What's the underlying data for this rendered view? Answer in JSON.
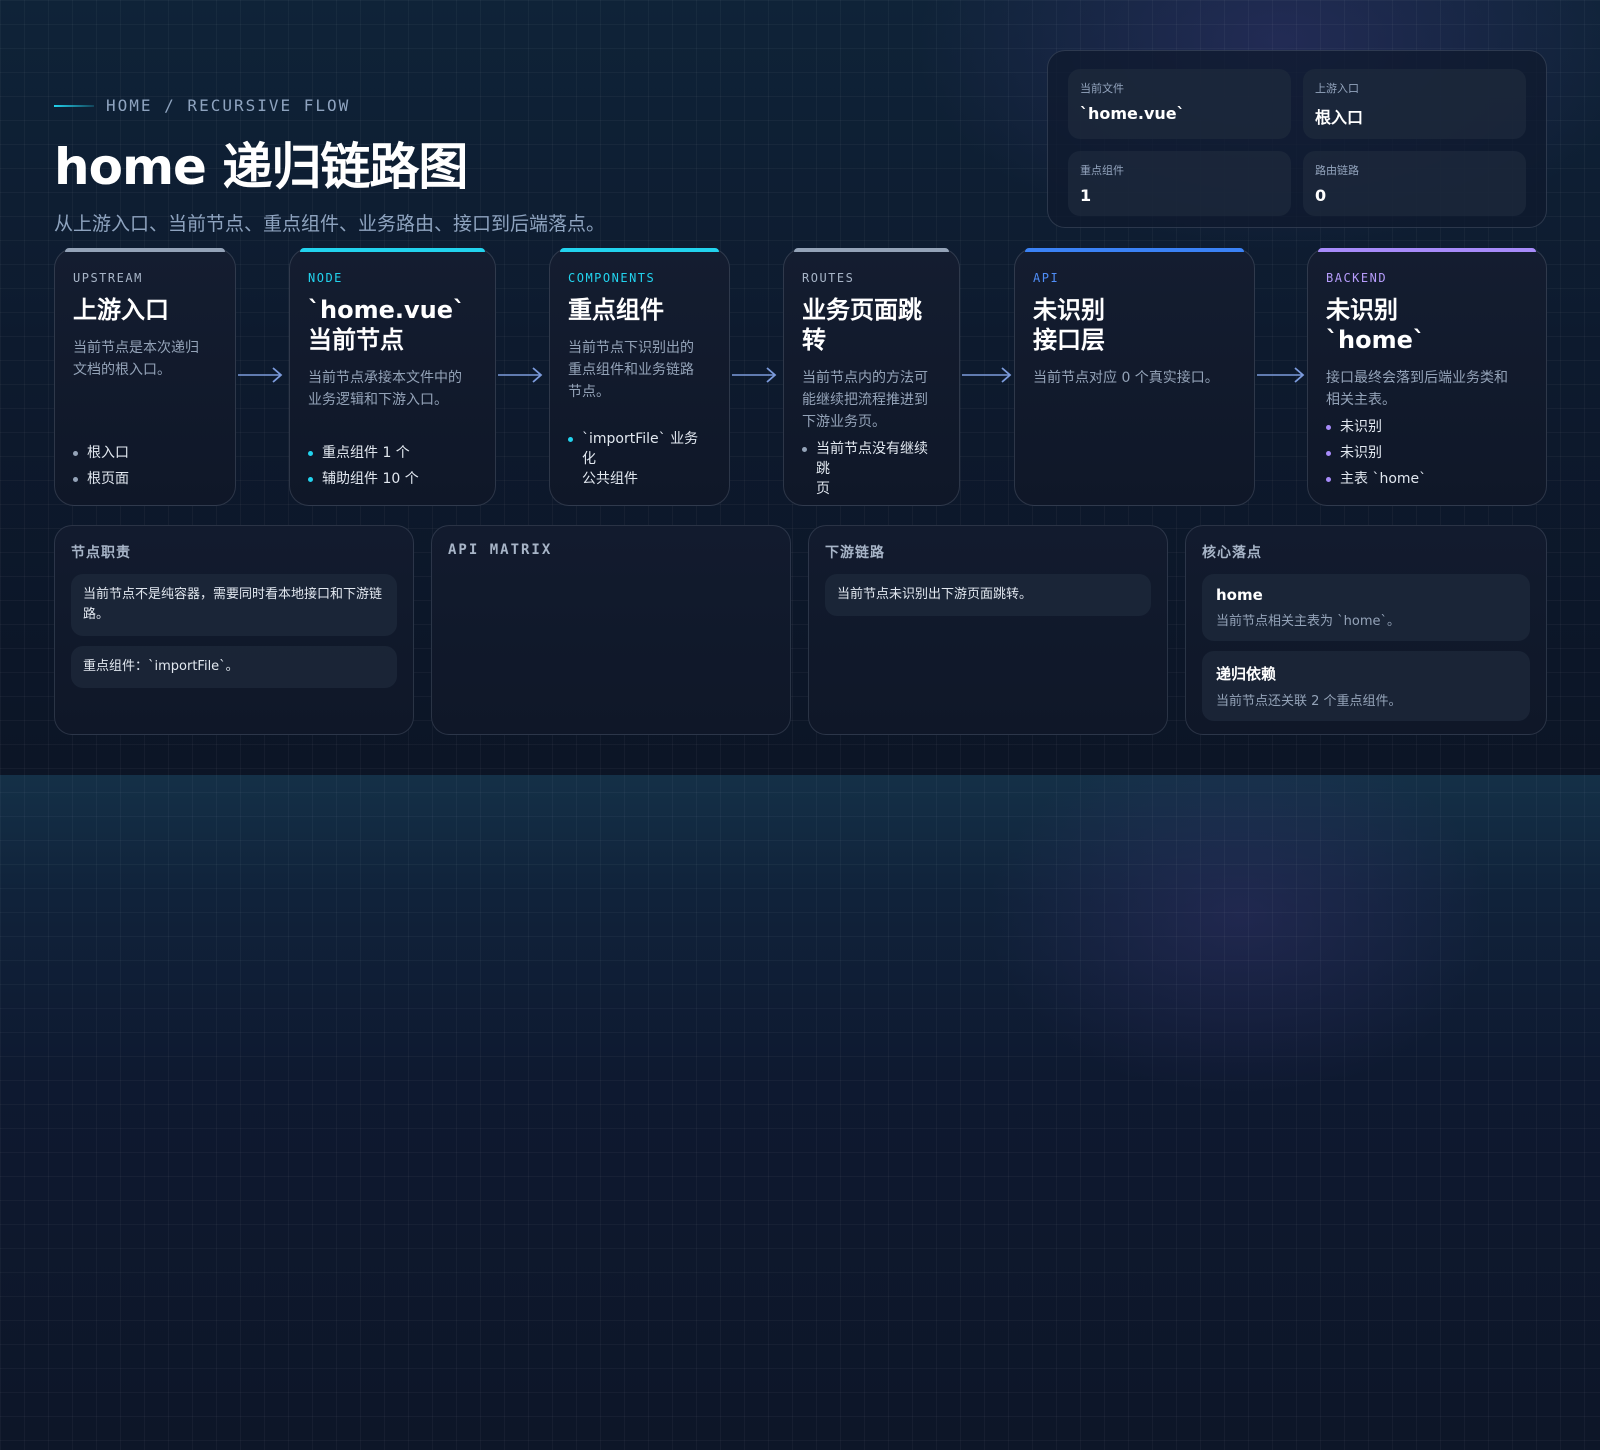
{
  "breadcrumb": "HOME / RECURSIVE FLOW",
  "title": "home 递归链路图",
  "subtitle": "从上游入口、当前节点、重点组件、业务路由、接口到后端落点。",
  "stats": [
    {
      "label": "当前文件",
      "value": "`home.vue`"
    },
    {
      "label": "上游入口",
      "value": "根入口"
    },
    {
      "label": "重点组件",
      "value": "1"
    },
    {
      "label": "路由链路",
      "value": "0"
    }
  ],
  "flow": [
    {
      "tag": "UPSTREAM",
      "title": "上游入口",
      "desc": "当前节点是本次递归\n文档的根入口。",
      "bullets": [
        "根入口",
        "根页面"
      ]
    },
    {
      "tag": "NODE",
      "title": "`home.vue`\n当前节点",
      "desc": "当前节点承接本文件中的\n业务逻辑和下游入口。",
      "bullets": [
        "重点组件 1 个",
        "辅助组件 10 个"
      ]
    },
    {
      "tag": "COMPONENTS",
      "title": "重点组件",
      "desc": "当前节点下识别出的\n重点组件和业务链路\n节点。",
      "bullets": [
        "`importFile` 业务化\n公共组件"
      ]
    },
    {
      "tag": "ROUTES",
      "title": "业务页面跳\n转",
      "desc": "当前节点内的方法可\n能继续把流程推进到\n下游业务页。",
      "bullets": [
        "当前节点没有继续跳\n页"
      ]
    },
    {
      "tag": "API",
      "title": "未识别\n接口层",
      "desc": "当前节点对应 0 个真实接口。",
      "bullets": []
    },
    {
      "tag": "BACKEND",
      "title": "未识别\n`home`",
      "desc": "接口最终会落到后端业务类和\n相关主表。",
      "bullets": [
        "未识别",
        "未识别",
        "主表 `home`"
      ]
    }
  ],
  "panels": {
    "duty": {
      "title": "节点职责",
      "items": [
        "当前节点不是纯容器，需要同时看本地接口和下游链路。",
        "重点组件：`importFile`。"
      ]
    },
    "api": {
      "title": "API MATRIX"
    },
    "downstream": {
      "title": "下游链路",
      "items": [
        "当前节点未识别出下游页面跳转。"
      ]
    },
    "core": {
      "title": "核心落点",
      "items": [
        {
          "name": "home",
          "desc": "当前节点相关主表为 `home`。"
        },
        {
          "name": "递归依赖",
          "desc": "当前节点还关联 2 个重点组件。"
        }
      ]
    }
  },
  "colors": {
    "upstream": "#94a3b8",
    "node": "#22d3ee",
    "components": "#22d3ee",
    "routes": "#94a3b8",
    "api": "#3b82f6",
    "backend": "#a78bfa",
    "arrow": "#7c9bdc"
  }
}
